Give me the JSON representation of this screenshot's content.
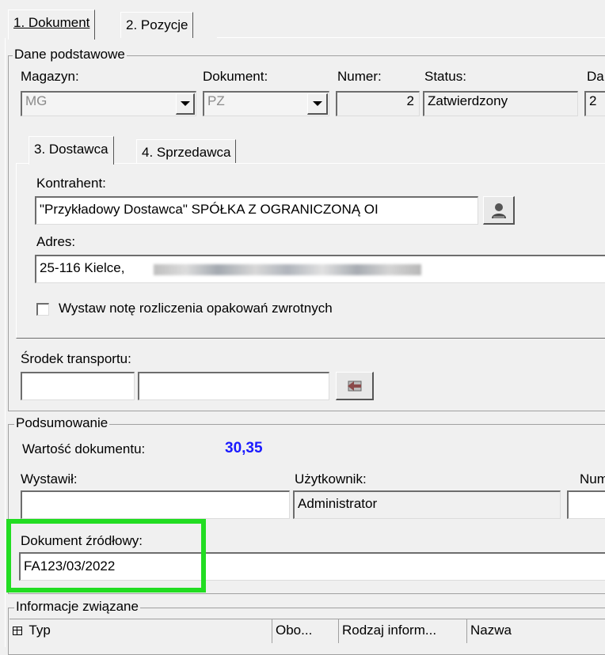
{
  "tabs": {
    "tab1": "1. Dokument",
    "tab2": "2. Pozycje"
  },
  "dane": {
    "title": "Dane podstawowe",
    "magazyn_label": "Magazyn:",
    "magazyn_value": "MG",
    "dokument_label": "Dokument:",
    "dokument_value": "PZ",
    "numer_label": "Numer:",
    "numer_value": "2",
    "status_label": "Status:",
    "status_value": "Zatwierdzony",
    "data_label": "Da",
    "data_value": "2"
  },
  "subtabs": {
    "tab3": "3. Dostawca",
    "tab4": "4. Sprzedawca"
  },
  "dostawca": {
    "kontrahent_label": "Kontrahent:",
    "kontrahent_value": "\"Przykładowy Dostawca\" SPÓŁKA Z OGRANICZONĄ OI",
    "adres_label": "Adres:",
    "adres_value": "25-116 Kielce,",
    "checkbox_label": "Wystaw notę rozliczenia opakowań zwrotnych"
  },
  "transport": {
    "label": "Środek transportu:"
  },
  "podsumowanie": {
    "title": "Podsumowanie",
    "wartosc_label": "Wartość dokumentu:",
    "wartosc_value": "30,35",
    "wartosc_color": "#1a1aff",
    "wystawil_label": "Wystawił:",
    "wystawil_value": "",
    "uzytkownik_label": "Użytkownik:",
    "uzytkownik_value": "Administrator",
    "numer_label": "Num",
    "zrodlowy_label": "Dokument źródłowy:",
    "zrodlowy_value": "FA123/03/2022",
    "highlight_color": "#22dd22"
  },
  "informacje": {
    "title": "Informacje związane",
    "columns": [
      "Typ",
      "Obo...",
      "Rodzaj inform...",
      "Nazwa"
    ]
  }
}
